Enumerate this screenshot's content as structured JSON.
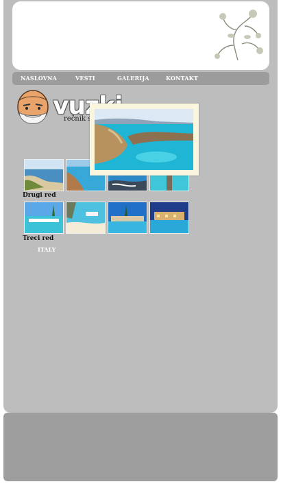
{
  "nav": {
    "items": [
      "NASLOVNA",
      "VESTI",
      "GALERIJA",
      "KONTAKT"
    ]
  },
  "logo": {
    "title": "vuz",
    "title_tail": "ki",
    "subtitle": "rečnik sl"
  },
  "gallery": {
    "row2_label": "Drugi red",
    "row3_label": "Treci red",
    "country_link": "ITALY"
  },
  "colors": {
    "panel": "#bdbdbd",
    "navbar": "#9c9c9c",
    "footer": "#9e9e9e",
    "popup_bg": "#f9f6dd"
  },
  "icons": {
    "ornament": "floral-ornament-icon",
    "mascot": "bearded-man-mascot-icon"
  }
}
